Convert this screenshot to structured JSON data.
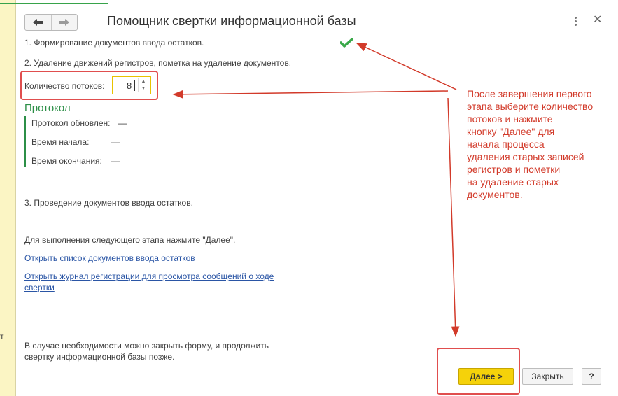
{
  "window": {
    "title": "Помощник свертки информационной базы",
    "left_letter": "т"
  },
  "steps": {
    "step1": "1. Формирование документов ввода остатков.",
    "step2": "2. Удаление движений регистров, пометка на удаление документов.",
    "step3": "3. Проведение документов ввода остатков."
  },
  "threads": {
    "label": "Количество потоков:",
    "value": "8"
  },
  "protocol": {
    "title": "Протокол",
    "updated_label": "Протокол обновлен:",
    "updated_value": "—",
    "start_label": "Время начала:",
    "start_value": "—",
    "end_label": "Время окончания:",
    "end_value": "—"
  },
  "info": {
    "next_hint": "Для выполнения следующего этапа нажмите \"Далее\".",
    "link_documents": "Открыть список документов ввода остатков",
    "link_log_line1": "Открыть журнал регистрации для просмотра сообщений о ходе",
    "link_log_line2": "свертки",
    "close_hint_line1": "В случае необходимости можно закрыть форму, и продолжить",
    "close_hint_line2": "свертку информационной базы позже."
  },
  "annotation": {
    "lines": [
      "После завершения первого",
      "этапа выберите количество",
      "потоков и нажмите",
      "кнопку \"Далее\" для",
      "начала процесса",
      "удаления старых записей",
      "регистров и пометки",
      "на удаление старых",
      "документов."
    ]
  },
  "buttons": {
    "next": "Далее >",
    "close": "Закрыть",
    "help": "?"
  },
  "icons": {
    "back": "arrow-left-icon",
    "forward": "arrow-right-icon",
    "more": "kebab-menu-icon",
    "close": "close-icon",
    "done": "checkmark-icon"
  },
  "colors": {
    "accent_yellow": "#f5d20a",
    "annotation_red": "#d23a2a",
    "protocol_green": "#2c8f47",
    "check_green": "#3aa94a",
    "link_blue": "#2a55a5"
  }
}
